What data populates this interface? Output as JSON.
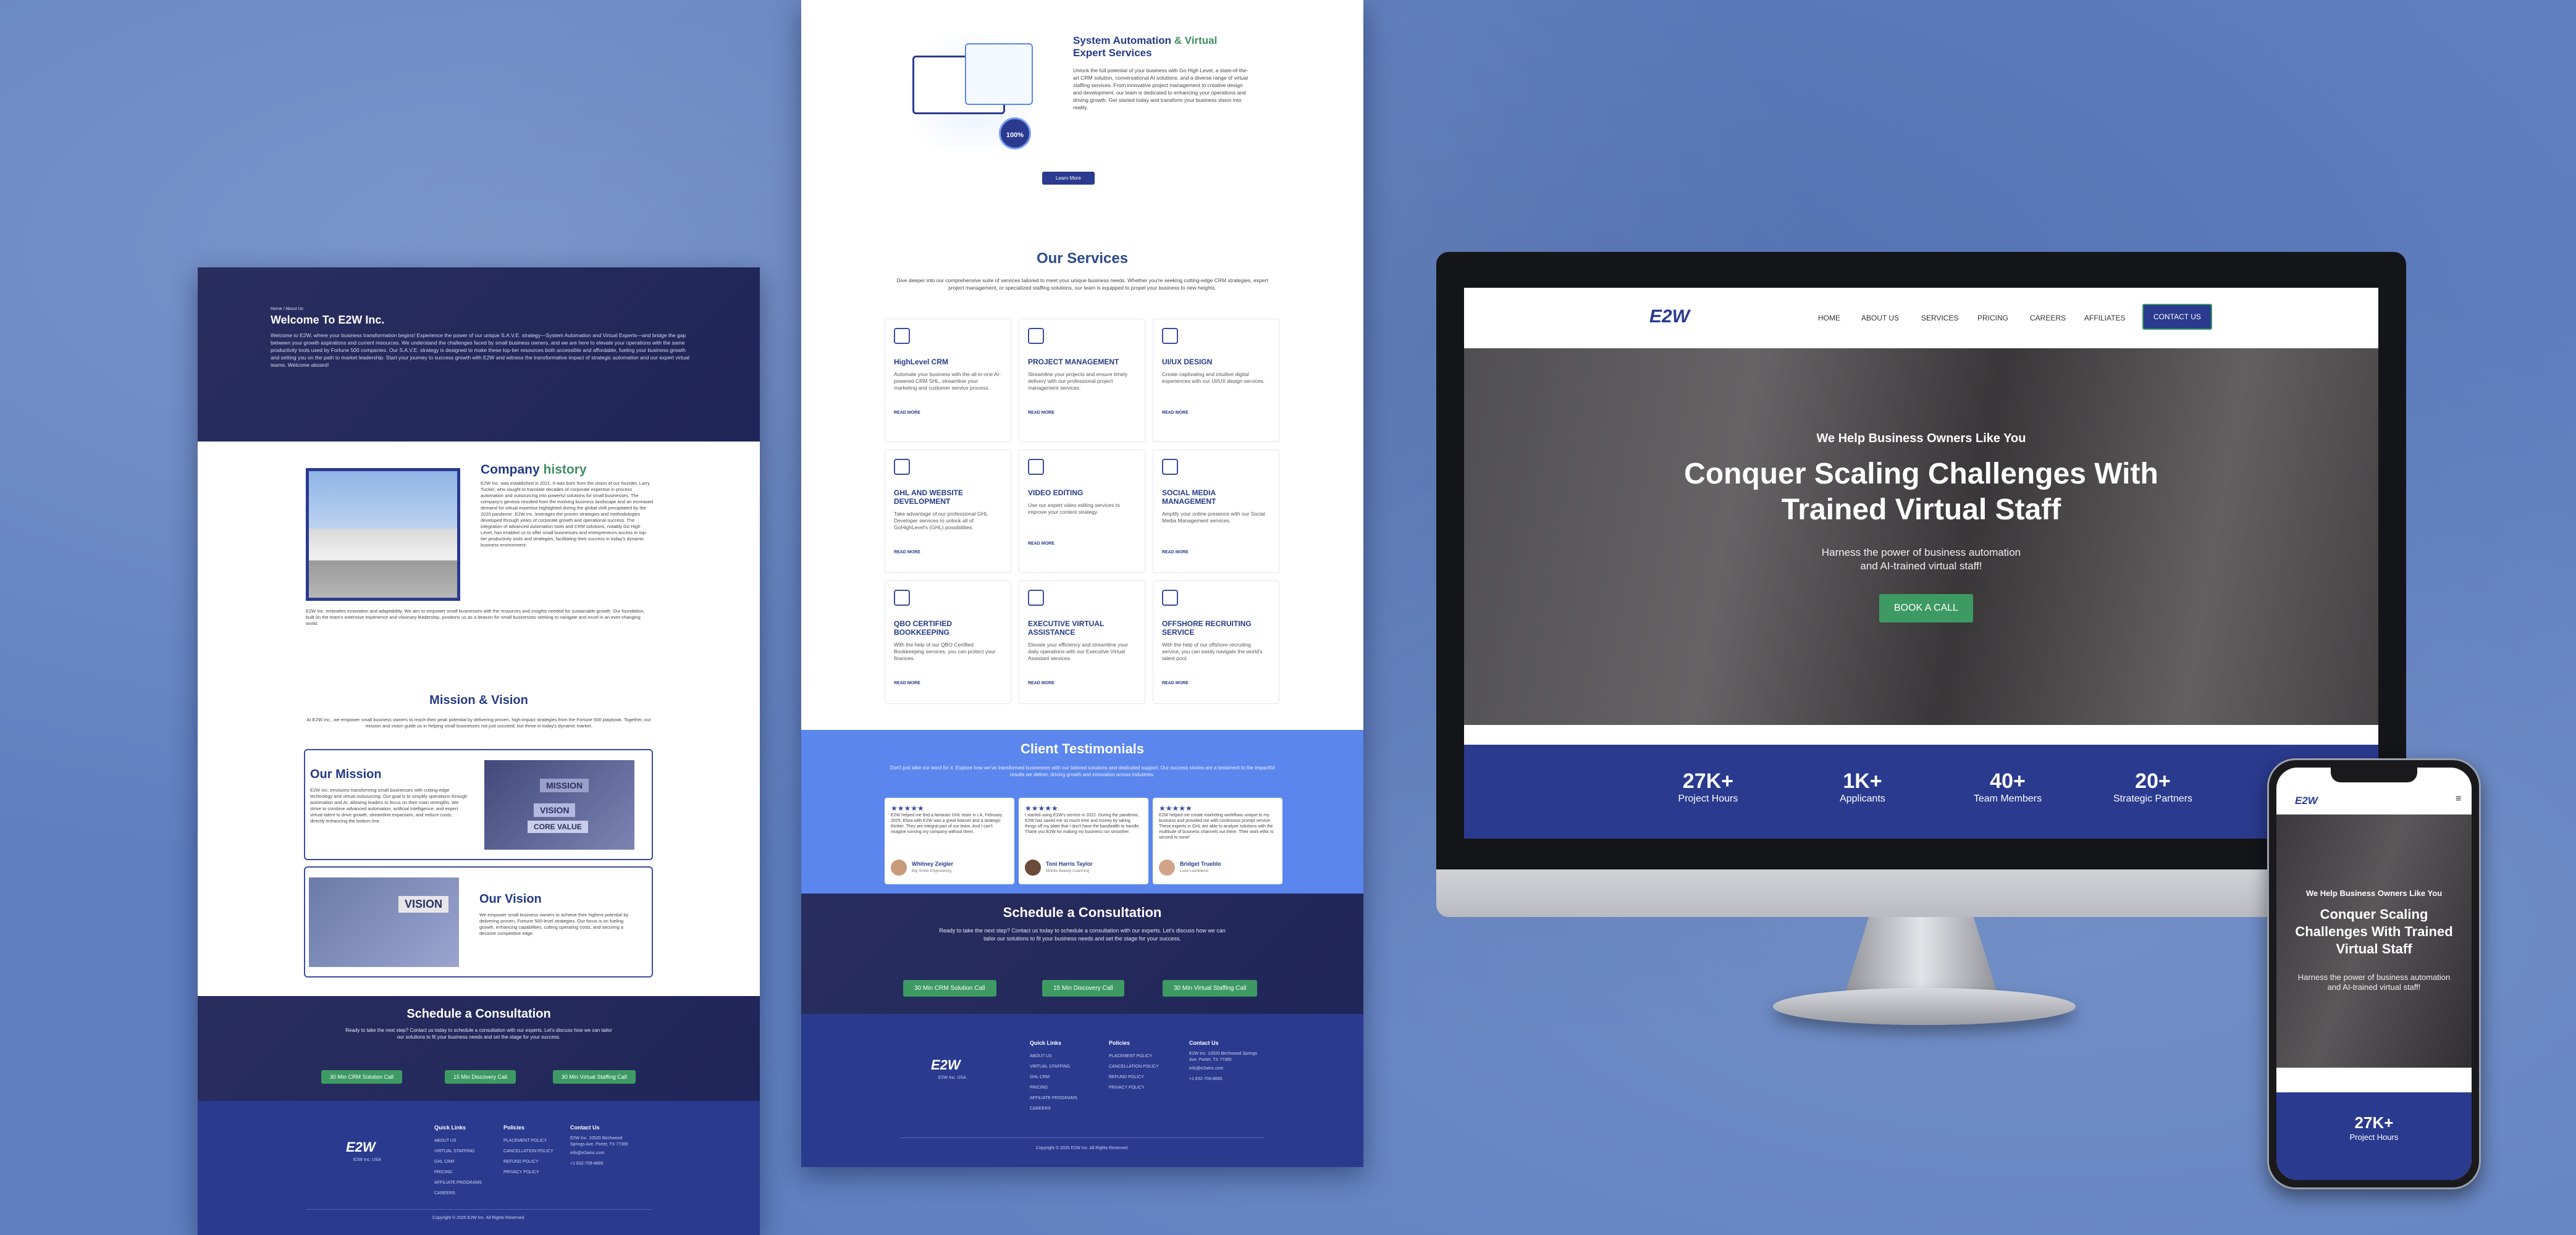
{
  "brand": {
    "logo": "E2W",
    "footer_logo_sub": "E2W Inc. USA"
  },
  "colors": {
    "navy": "#2a3a8f",
    "green": "#3e9a63",
    "blue_band": "#5b86ee",
    "background": "#5f7fbf"
  },
  "left": {
    "breadcrumb": "Home / About Us",
    "hero_title": "Welcome To E2W Inc.",
    "hero_text": "Welcome to E2W, where your business transformation begins! Experience the power of our unique S.A.V.E. strategy—System Automation and Virtual Experts—and bridge the gap between your growth aspirations and current resources. We understand the challenges faced by small business owners, and we are here to elevate your operations with the same productivity tools used by Fortune 500 companies. Our S.A.V.E. strategy is designed to make these top-tier resources both accessible and affordable, fueling your business growth and setting you on the path to market leadership. Start your journey to success growth with E2W and witness the transformative impact of strategic automation and our expert virtual teams. Welcome aboard!",
    "history_title_a": "Company",
    "history_title_b": "history",
    "history_text": "E2W Inc. was established in 2021. It was born from the vision of our founder, Larry Tucker, who sought to translate decades of corporate expertise in process automation and outsourcing into powerful solutions for small businesses. The company's genesis resulted from the evolving business landscape and an increased demand for virtual expertise highlighted during the global shift precipitated by the 2020 pandemic. E2W Inc. leverages the proven strategies and methodologies developed through years of corporate growth and operational success. The integration of advanced automation tools and CRM solutions, notably Go High Level, has enabled us to offer small businesses and entrepreneurs access to top-tier productivity tools and strategies, facilitating their success in today's dynamic business environment.",
    "history_text2": "E2W Inc. embodies innovation and adaptability. We aim to empower small businesses with the resources and insights needed for sustainable growth. Our foundation, built on the team's extensive experience and visionary leadership, positions us as a beacon for small businesses seeking to navigate and excel in an ever-changing world.",
    "mv_title": "Mission & Vision",
    "mv_text": "At E2W Inc., we empower small business owners to reach their peak potential by delivering proven, high-impact strategies from the Fortune 500 playbook. Together, our mission and vision guide us in helping small businesses not just succeed, but thrive in today's dynamic market.",
    "mission_title": "Our Mission",
    "mission_text": "E2W Inc. envisions transforming small businesses with cutting-edge technology and virtual outsourcing. Our goal is to simplify operations through automation and AI, allowing leaders to focus on their main strengths. We strive to combine advanced automation, artificial intelligence, and expert virtual talent to drive growth, streamline expansion, and reduce costs, directly enhancing the bottom line.",
    "vision_title": "Our Vision",
    "vision_text": "We empower small business owners to achieve their highest potential by delivering proven, Fortune 500-level strategies. Our focus is on fueling growth, enhancing capabilities, cutting operating costs, and securing a decisive competitive edge.",
    "img_mission": "MISSION",
    "img_vision": "VISION",
    "img_core": "CORE VALUE",
    "img_vision2": "VISION",
    "sched_title": "Schedule a Consultation",
    "sched_text": "Ready to take the next step? Contact us today to schedule a consultation with our experts. Let's discuss how we can tailor our solutions to fit your business needs and set the stage for your success.",
    "btns": [
      "30 Min CRM Solution Call",
      "15 Min Discovery Call",
      "30 Min Virtual Staffing Call"
    ],
    "copyright": "Copyright © 2025 E2W Inc. All Rights Reserved."
  },
  "mid": {
    "auto_title_a": "System Automation",
    "auto_title_b": "& Virtual",
    "auto_title_c": "Expert Services",
    "auto_text": "Unlock the full potential of your business with Go High Level, a state-of-the-art CRM solution, conversational AI solutions, and a diverse range of virtual staffing services. From innovative project management to creative design and development, our team is dedicated to enhancing your operations and driving growth. Get started today and transform your business vision into reality.",
    "badge": "100%",
    "learn_more": "Learn More",
    "services_title": "Our Services",
    "services_text": "Dive deeper into our comprehensive suite of services tailored to meet your unique business needs. Whether you're seeking cutting-edge CRM strategies, expert project management, or specialized staffing solutions, our team is equipped to propel your business to new heights.",
    "read_more": "READ MORE",
    "services": [
      {
        "title": "HighLevel CRM",
        "desc": "Automate your business with the all-in-one AI-powered CRM SHL, streamline your marketing and customer service process."
      },
      {
        "title": "PROJECT MANAGEMENT",
        "desc": "Streamline your projects and ensure timely delivery with our professional project management services."
      },
      {
        "title": "UI/UX DESIGN",
        "desc": "Create captivating and intuitive digital experiences with our UI/UX design services."
      },
      {
        "title": "GHL AND WEBSITE DEVELOPMENT",
        "desc": "Take advantage of our professional GHL Developer services to unlock all of GoHighLevel's (GHL) possibilities."
      },
      {
        "title": "VIDEO EDITING",
        "desc": "Use our expert video editing services to improve your content strategy."
      },
      {
        "title": "SOCIAL MEDIA MANAGEMENT",
        "desc": "Amplify your online presence with our Social Media Management services."
      },
      {
        "title": "QBO CERTIFIED BOOKKEEPING",
        "desc": "With the help of our QBO Certified Bookkeeping services, you can protect your finances."
      },
      {
        "title": "EXECUTIVE VIRTUAL ASSISTANCE",
        "desc": "Elevate your efficiency and streamline your daily operations with our Executive Virtual Assistant services."
      },
      {
        "title": "OFFSHORE RECRUITING SERVICE",
        "desc": "With the help of our offshore recruiting service, you can easily navigate the world's talent pool."
      }
    ],
    "testi_title": "Client Testimonials",
    "testi_text": "Don't just take our word for it. Explore how we've transformed businesses with our tailored solutions and dedicated support. Our success stories are a testament to the impactful results we deliver, driving growth and innovation across industries.",
    "testimonials": [
      {
        "stars": "★★★★★",
        "text": "E2W helped me find a fantastic GHL team in LA, February 2025. Elora with E2W was a great listener and a strategic thinker. They are integral part of our team. And I can't imagine running my company without them.",
        "name": "Whitney Zeigler",
        "role": "Big Smile Engineering"
      },
      {
        "stars": "★★★★★",
        "text": "I started using E2W's service in 2022. During the pandemic, E2W has saved me so much time and money by taking things off my plate that I don't have the bandwidth to handle. Thank you E2W for making my business run smoother.",
        "name": "Toni Harris Taylor",
        "role": "Mobile Beauty Coaching"
      },
      {
        "stars": "★★★★★",
        "text": "E2W helped me create marketing workflows unique to my business and provided me with continuous prompt service. These experts in GHL are able to analyze solutions with the multitude of business channels out there. Their work ethic is second to none!",
        "name": "Bridget Trueblo",
        "role": "Luxe Lashblend"
      }
    ],
    "sched_title": "Schedule a Consultation",
    "sched_text": "Ready to take the next step? Contact us today to schedule a consultation with our experts. Let's discuss how we can tailor our solutions to fit your business needs and set the stage for your success.",
    "btns": [
      "30 Min CRM Solution Call",
      "15 Min Discovery Call",
      "30 Min Virtual Staffing Call"
    ],
    "copyright": "Copyright © 2025 E2W Inc. All Rights Reserved."
  },
  "footer": {
    "quick_links": "Quick Links",
    "quick_items": [
      "ABOUT US",
      "VIRTUAL STAFFING",
      "GHL CRM",
      "PRICING",
      "AFFILIATE PROGRAMS",
      "CAREERS"
    ],
    "policies": "Policies",
    "policy_items": [
      "PLACEMENT POLICY",
      "CANCELLATION POLICY",
      "REFUND POLICY",
      "PRIVACY POLICY"
    ],
    "contact": "Contact Us",
    "address": "E2W Inc. 10520 Birchwood Springs Ave. Porter, TX 77365",
    "email": "info@e2winc.com",
    "phone": "+1 832-709-8865"
  },
  "desktop": {
    "nav": [
      "HOME",
      "ABOUT US",
      "SERVICES",
      "PRICING",
      "CAREERS",
      "AFFILIATES"
    ],
    "contact_btn": "CONTACT US",
    "kicker": "We Help Business Owners Like You",
    "title": "Conquer Scaling Challenges With Trained Virtual Staff",
    "sub": "Harness the power of business automation and AI-trained virtual staff!",
    "cta": "BOOK A CALL",
    "stats": [
      {
        "value": "27K+",
        "label": "Project Hours"
      },
      {
        "value": "1K+",
        "label": "Applicants"
      },
      {
        "value": "40+",
        "label": "Team Members"
      },
      {
        "value": "20+",
        "label": "Strategic Partners"
      }
    ]
  },
  "phone": {
    "kicker": "We Help Business Owners Like You",
    "title": "Conquer Scaling Challenges With Trained Virtual Staff",
    "sub": "Harness the power of business automation and AI-trained virtual staff!",
    "stat_value": "27K+",
    "stat_label": "Project Hours",
    "menu": "≡"
  }
}
